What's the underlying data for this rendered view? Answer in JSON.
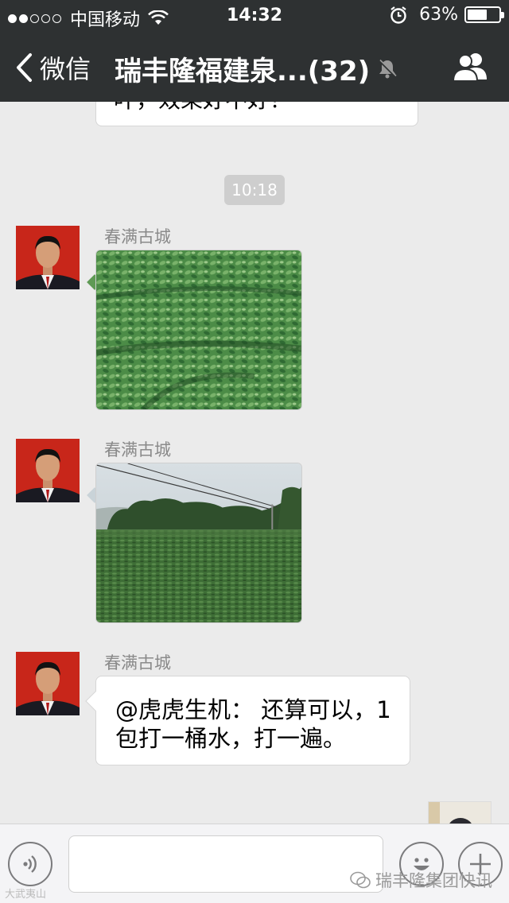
{
  "status_bar": {
    "signal_dots_filled": 2,
    "signal_dots_total": 5,
    "carrier": "中国移动",
    "time": "14:32",
    "battery": "63%",
    "battery_level": 0.63
  },
  "nav": {
    "back_label": "微信",
    "title": "瑞丰隆福建泉...(32)"
  },
  "messages": {
    "top_partial": "叶，效果好不好？",
    "timestamp": "10:18",
    "msg1_sender": "春满古城",
    "msg2_sender": "春满古城",
    "msg3_sender": "春满古城",
    "msg3_text_line1": "@虎虎生机： 还算可以，1",
    "msg3_text_line2": "包打一桶水，打一遍。"
  },
  "input_bar": {
    "placeholder": ""
  },
  "watermark": {
    "left": "大武夷山",
    "right": "瑞丰隆集团快讯"
  },
  "colors": {
    "header_bg": "#2e3132",
    "chat_bg": "#ebebeb",
    "avatar_red": "#c8261a",
    "tea_green": "#3d7a3e"
  }
}
